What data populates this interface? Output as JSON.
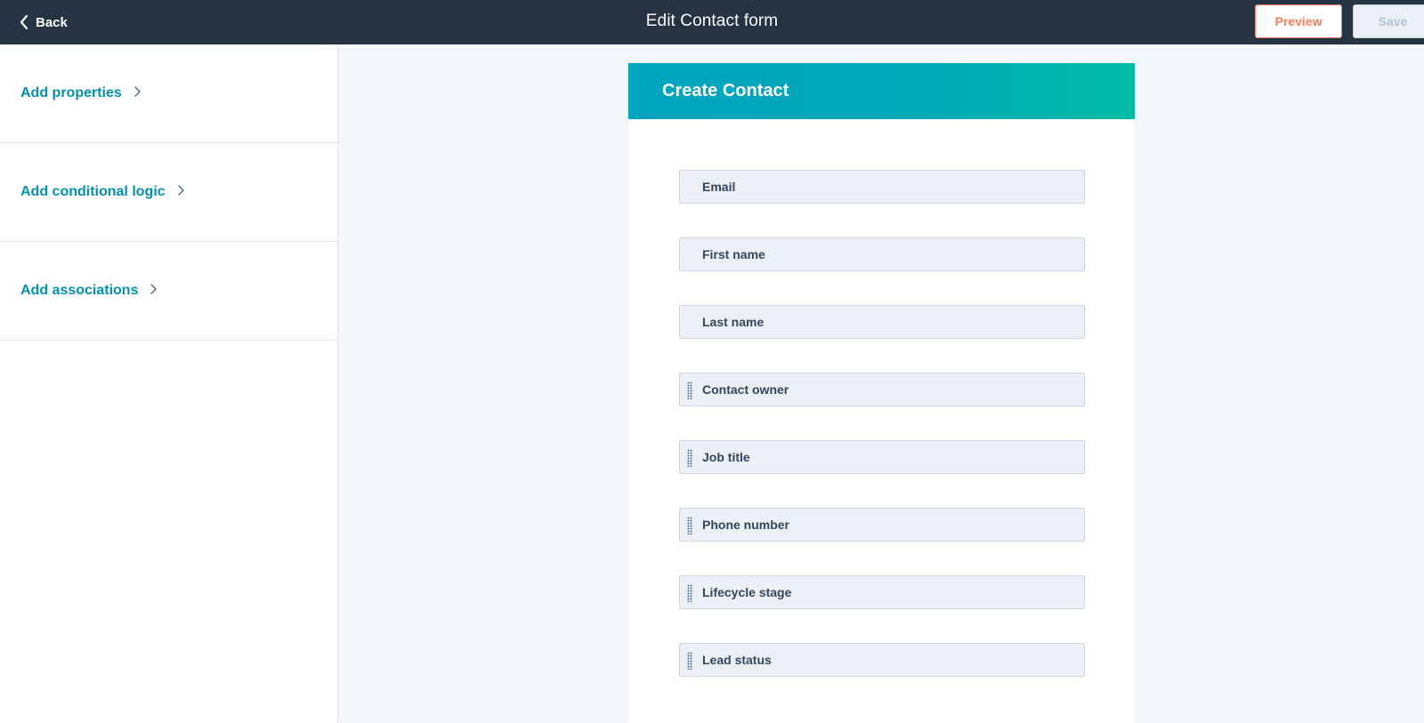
{
  "header": {
    "back_label": "Back",
    "title": "Edit Contact form",
    "preview_label": "Preview",
    "save_label": "Save"
  },
  "sidebar": {
    "items": [
      {
        "label": "Add properties"
      },
      {
        "label": "Add conditional logic"
      },
      {
        "label": "Add associations"
      }
    ]
  },
  "form": {
    "title": "Create Contact",
    "fields": [
      {
        "label": "Email",
        "draggable": false
      },
      {
        "label": "First name",
        "draggable": false
      },
      {
        "label": "Last name",
        "draggable": false
      },
      {
        "label": "Contact owner",
        "draggable": true
      },
      {
        "label": "Job title",
        "draggable": true
      },
      {
        "label": "Phone number",
        "draggable": true
      },
      {
        "label": "Lifecycle stage",
        "draggable": true
      },
      {
        "label": "Lead status",
        "draggable": true
      }
    ]
  },
  "colors": {
    "topbar": "#253342",
    "link": "#0091ae",
    "preview_accent": "#ff7a59",
    "header_gradient_start": "#00a4bd",
    "header_gradient_end": "#00bda5"
  },
  "icons": {
    "back": "chevron-left-icon",
    "sidebar_link": "chevron-right-icon",
    "drag": "drag-handle-icon"
  }
}
